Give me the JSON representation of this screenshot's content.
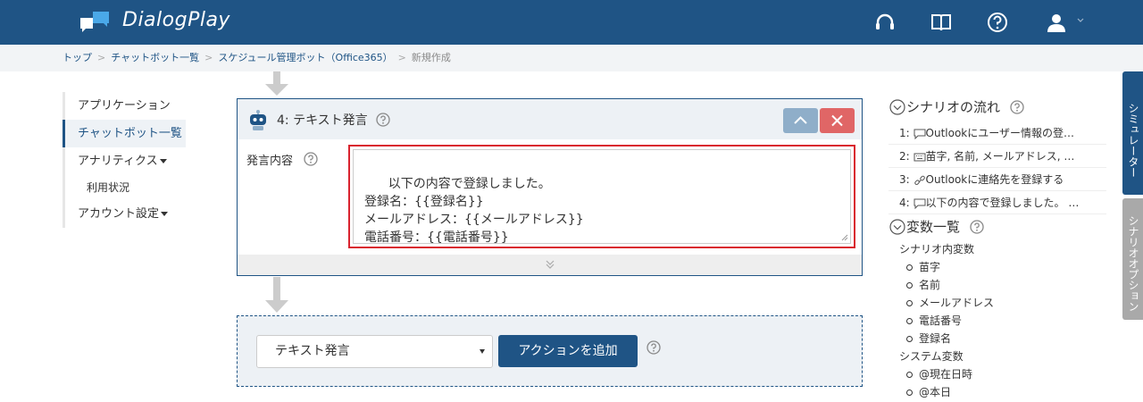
{
  "header": {
    "app_name": "DialogPlay",
    "bg_color": "#1f5485",
    "icons": [
      "headset-icon",
      "book-icon",
      "help-circle-icon",
      "user-icon",
      "chevron-down-icon"
    ]
  },
  "breadcrumb": {
    "items": [
      "トップ",
      "チャットボット一覧",
      "スケジュール管理ボット（Office365）"
    ],
    "current": "新規作成",
    "separator": ">"
  },
  "leftnav": {
    "items": [
      "アプリケーション",
      "チャットボット一覧",
      "アナリティクス",
      "利用状況",
      "アカウント設定"
    ]
  },
  "card": {
    "title": "4: テキスト発言",
    "field_label": "発言内容",
    "textarea_value": "以下の内容で登録しました。\n登録名：{{登録名}}\nメールアドレス：{{メールアドレス}}\n電話番号：{{電話番号}}"
  },
  "addarea": {
    "selected_action": "テキスト発言",
    "add_button": "アクションを追加"
  },
  "rpanel": {
    "flow_title": "シナリオの流れ",
    "flow_items": [
      {
        "num": "1:",
        "icon": "speech-bubble-icon",
        "text": "Outlookにユーザー情報の登…"
      },
      {
        "num": "2:",
        "icon": "keyboard-icon",
        "text": "苗字, 名前, メールアドレス, …"
      },
      {
        "num": "3:",
        "icon": "link-icon",
        "text": "Outlookに連絡先を登録する"
      },
      {
        "num": "4:",
        "icon": "speech-bubble-icon",
        "text": "以下の内容で登録しました。 …"
      }
    ],
    "vars_title": "変数一覧",
    "scenario_vars_label": "シナリオ内変数",
    "scenario_vars": [
      "苗字",
      "名前",
      "メールアドレス",
      "電話番号",
      "登録名"
    ],
    "system_vars_label": "システム変数",
    "system_vars": [
      "@現在日時",
      "@本日"
    ]
  },
  "tabs": {
    "simulator": "シミュレーター",
    "options": "シナリオオプション"
  }
}
